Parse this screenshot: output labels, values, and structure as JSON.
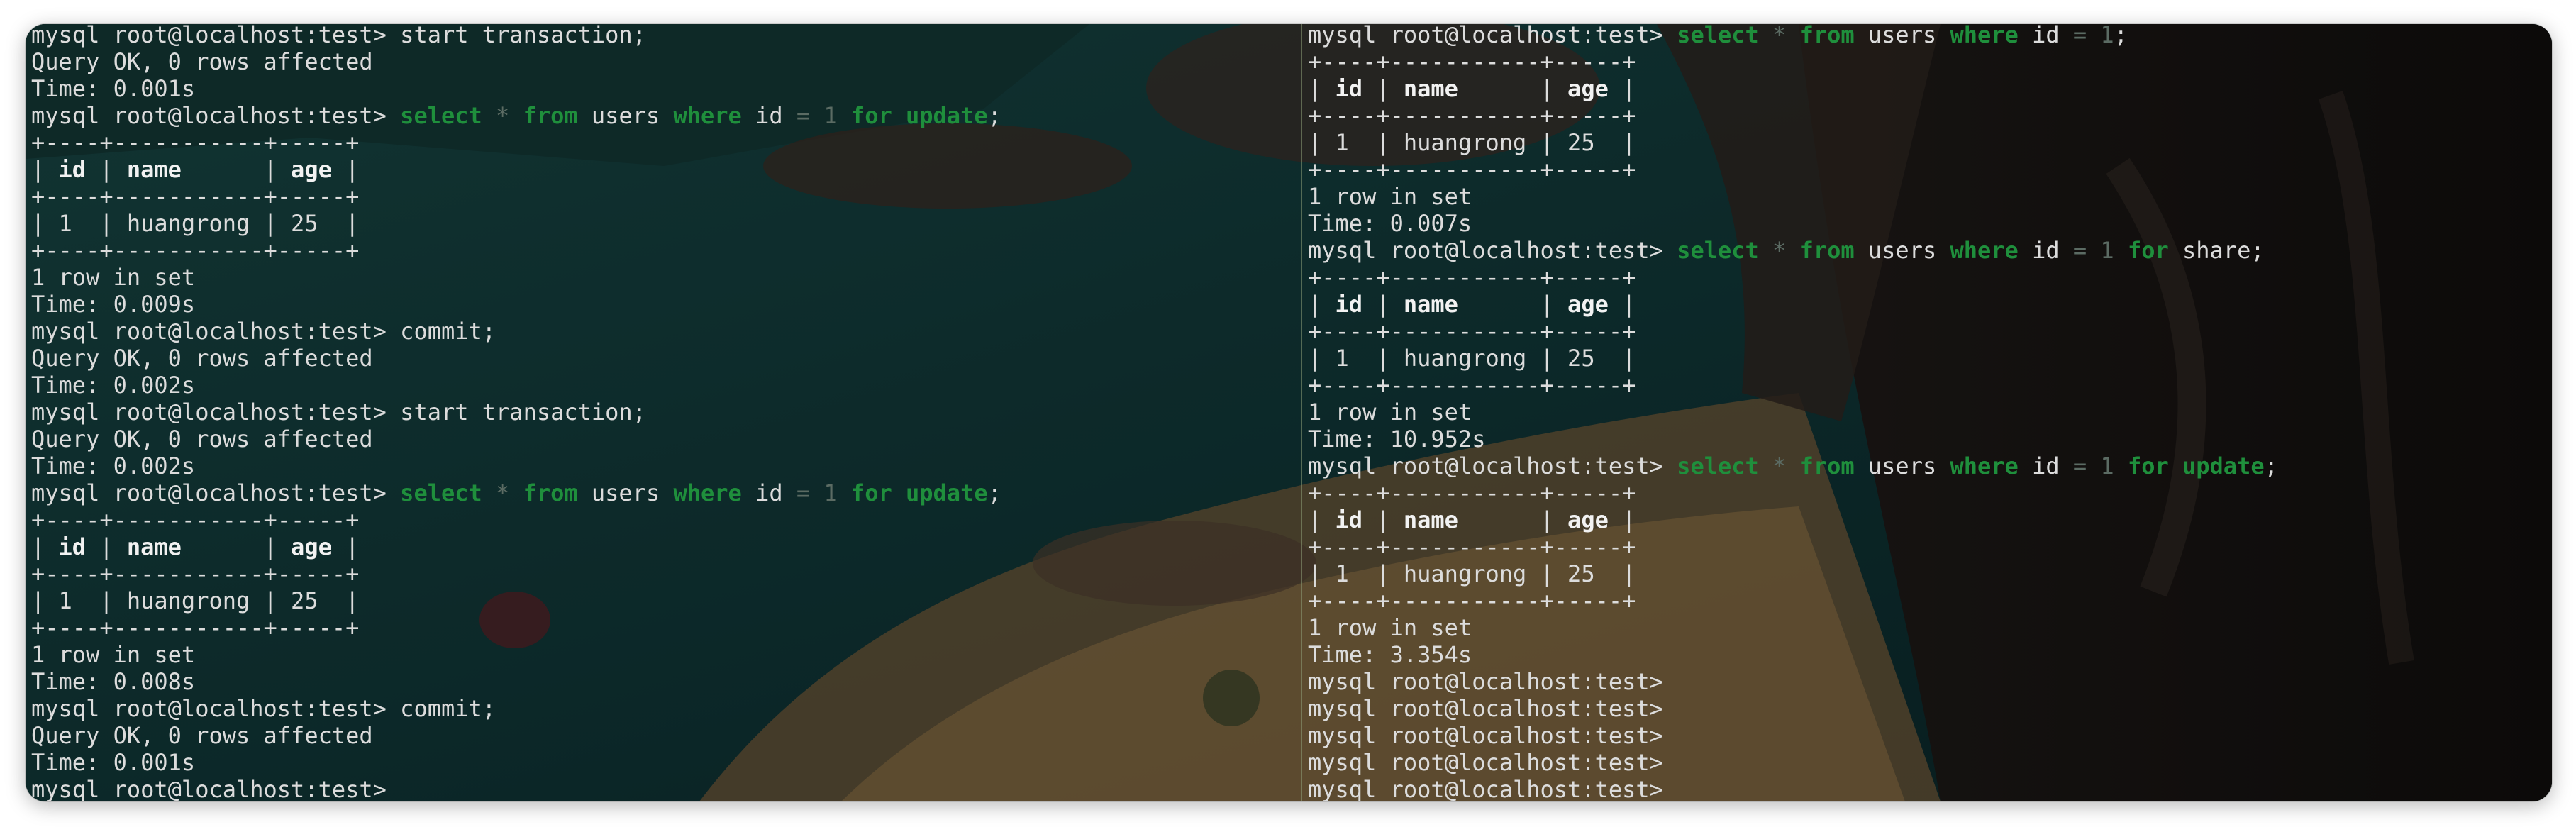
{
  "colors": {
    "text": "#dcdcdc",
    "keyword": "#1f8f3c",
    "dim": "#5b6b63",
    "header": "#f2f2f2",
    "divider": "#8fa07a"
  },
  "terminal": {
    "left_pane": [
      [
        {
          "t": "mysql root@localhost:test> start transaction;"
        }
      ],
      [
        {
          "t": "Query OK, 0 rows affected"
        }
      ],
      [
        {
          "t": "Time: 0.001s"
        }
      ],
      [
        {
          "t": "mysql root@localhost:test> "
        },
        {
          "t": "select",
          "c": "kw"
        },
        {
          "t": " "
        },
        {
          "t": "*",
          "c": "dim"
        },
        {
          "t": " "
        },
        {
          "t": "from",
          "c": "kw"
        },
        {
          "t": " users "
        },
        {
          "t": "where",
          "c": "kw"
        },
        {
          "t": " id "
        },
        {
          "t": "=",
          "c": "dim"
        },
        {
          "t": " "
        },
        {
          "t": "1",
          "c": "dim"
        },
        {
          "t": " "
        },
        {
          "t": "for",
          "c": "kw"
        },
        {
          "t": " "
        },
        {
          "t": "update",
          "c": "kw"
        },
        {
          "t": ";"
        }
      ],
      [
        {
          "t": "+----+-----------+-----+"
        }
      ],
      [
        {
          "t": "| "
        },
        {
          "t": "id",
          "c": "bold"
        },
        {
          "t": " | "
        },
        {
          "t": "name",
          "c": "bold"
        },
        {
          "t": "      | "
        },
        {
          "t": "age",
          "c": "bold"
        },
        {
          "t": " |"
        }
      ],
      [
        {
          "t": "+----+-----------+-----+"
        }
      ],
      [
        {
          "t": "| 1  | huangrong | 25  |"
        }
      ],
      [
        {
          "t": "+----+-----------+-----+"
        }
      ],
      [
        {
          "t": "1 row in set"
        }
      ],
      [
        {
          "t": "Time: 0.009s"
        }
      ],
      [
        {
          "t": "mysql root@localhost:test> commit;"
        }
      ],
      [
        {
          "t": "Query OK, 0 rows affected"
        }
      ],
      [
        {
          "t": "Time: 0.002s"
        }
      ],
      [
        {
          "t": "mysql root@localhost:test> start transaction;"
        }
      ],
      [
        {
          "t": "Query OK, 0 rows affected"
        }
      ],
      [
        {
          "t": "Time: 0.002s"
        }
      ],
      [
        {
          "t": "mysql root@localhost:test> "
        },
        {
          "t": "select",
          "c": "kw"
        },
        {
          "t": " "
        },
        {
          "t": "*",
          "c": "dim"
        },
        {
          "t": " "
        },
        {
          "t": "from",
          "c": "kw"
        },
        {
          "t": " users "
        },
        {
          "t": "where",
          "c": "kw"
        },
        {
          "t": " id "
        },
        {
          "t": "=",
          "c": "dim"
        },
        {
          "t": " "
        },
        {
          "t": "1",
          "c": "dim"
        },
        {
          "t": " "
        },
        {
          "t": "for",
          "c": "kw"
        },
        {
          "t": " "
        },
        {
          "t": "update",
          "c": "kw"
        },
        {
          "t": ";"
        }
      ],
      [
        {
          "t": "+----+-----------+-----+"
        }
      ],
      [
        {
          "t": "| "
        },
        {
          "t": "id",
          "c": "bold"
        },
        {
          "t": " | "
        },
        {
          "t": "name",
          "c": "bold"
        },
        {
          "t": "      | "
        },
        {
          "t": "age",
          "c": "bold"
        },
        {
          "t": " |"
        }
      ],
      [
        {
          "t": "+----+-----------+-----+"
        }
      ],
      [
        {
          "t": "| 1  | huangrong | 25  |"
        }
      ],
      [
        {
          "t": "+----+-----------+-----+"
        }
      ],
      [
        {
          "t": "1 row in set"
        }
      ],
      [
        {
          "t": "Time: 0.008s"
        }
      ],
      [
        {
          "t": "mysql root@localhost:test> commit;"
        }
      ],
      [
        {
          "t": "Query OK, 0 rows affected"
        }
      ],
      [
        {
          "t": "Time: 0.001s"
        }
      ],
      [
        {
          "t": "mysql root@localhost:test>"
        }
      ]
    ],
    "right_pane": [
      [
        {
          "t": "mysql root@localhost:test> "
        },
        {
          "t": "select",
          "c": "kw"
        },
        {
          "t": " "
        },
        {
          "t": "*",
          "c": "dim"
        },
        {
          "t": " "
        },
        {
          "t": "from",
          "c": "kw"
        },
        {
          "t": " users "
        },
        {
          "t": "where",
          "c": "kw"
        },
        {
          "t": " id "
        },
        {
          "t": "=",
          "c": "dim"
        },
        {
          "t": " "
        },
        {
          "t": "1",
          "c": "dim"
        },
        {
          "t": ";"
        }
      ],
      [
        {
          "t": "+----+-----------+-----+"
        }
      ],
      [
        {
          "t": "| "
        },
        {
          "t": "id",
          "c": "bold"
        },
        {
          "t": " | "
        },
        {
          "t": "name",
          "c": "bold"
        },
        {
          "t": "      | "
        },
        {
          "t": "age",
          "c": "bold"
        },
        {
          "t": " |"
        }
      ],
      [
        {
          "t": "+----+-----------+-----+"
        }
      ],
      [
        {
          "t": "| 1  | huangrong | 25  |"
        }
      ],
      [
        {
          "t": "+----+-----------+-----+"
        }
      ],
      [
        {
          "t": "1 row in set"
        }
      ],
      [
        {
          "t": "Time: 0.007s"
        }
      ],
      [
        {
          "t": "mysql root@localhost:test> "
        },
        {
          "t": "select",
          "c": "kw"
        },
        {
          "t": " "
        },
        {
          "t": "*",
          "c": "dim"
        },
        {
          "t": " "
        },
        {
          "t": "from",
          "c": "kw"
        },
        {
          "t": " users "
        },
        {
          "t": "where",
          "c": "kw"
        },
        {
          "t": " id "
        },
        {
          "t": "=",
          "c": "dim"
        },
        {
          "t": " "
        },
        {
          "t": "1",
          "c": "dim"
        },
        {
          "t": " "
        },
        {
          "t": "for",
          "c": "kw"
        },
        {
          "t": " share;"
        }
      ],
      [
        {
          "t": "+----+-----------+-----+"
        }
      ],
      [
        {
          "t": "| "
        },
        {
          "t": "id",
          "c": "bold"
        },
        {
          "t": " | "
        },
        {
          "t": "name",
          "c": "bold"
        },
        {
          "t": "      | "
        },
        {
          "t": "age",
          "c": "bold"
        },
        {
          "t": " |"
        }
      ],
      [
        {
          "t": "+----+-----------+-----+"
        }
      ],
      [
        {
          "t": "| 1  | huangrong | 25  |"
        }
      ],
      [
        {
          "t": "+----+-----------+-----+"
        }
      ],
      [
        {
          "t": "1 row in set"
        }
      ],
      [
        {
          "t": "Time: 10.952s"
        }
      ],
      [
        {
          "t": "mysql root@localhost:test> "
        },
        {
          "t": "select",
          "c": "kw"
        },
        {
          "t": " "
        },
        {
          "t": "*",
          "c": "dim"
        },
        {
          "t": " "
        },
        {
          "t": "from",
          "c": "kw"
        },
        {
          "t": " users "
        },
        {
          "t": "where",
          "c": "kw"
        },
        {
          "t": " id "
        },
        {
          "t": "=",
          "c": "dim"
        },
        {
          "t": " "
        },
        {
          "t": "1",
          "c": "dim"
        },
        {
          "t": " "
        },
        {
          "t": "for",
          "c": "kw"
        },
        {
          "t": " "
        },
        {
          "t": "update",
          "c": "kw"
        },
        {
          "t": ";"
        }
      ],
      [
        {
          "t": "+----+-----------+-----+"
        }
      ],
      [
        {
          "t": "| "
        },
        {
          "t": "id",
          "c": "bold"
        },
        {
          "t": " | "
        },
        {
          "t": "name",
          "c": "bold"
        },
        {
          "t": "      | "
        },
        {
          "t": "age",
          "c": "bold"
        },
        {
          "t": " |"
        }
      ],
      [
        {
          "t": "+----+-----------+-----+"
        }
      ],
      [
        {
          "t": "| 1  | huangrong | 25  |"
        }
      ],
      [
        {
          "t": "+----+-----------+-----+"
        }
      ],
      [
        {
          "t": "1 row in set"
        }
      ],
      [
        {
          "t": "Time: 3.354s"
        }
      ],
      [
        {
          "t": "mysql root@localhost:test>"
        }
      ],
      [
        {
          "t": "mysql root@localhost:test>"
        }
      ],
      [
        {
          "t": "mysql root@localhost:test>"
        }
      ],
      [
        {
          "t": "mysql root@localhost:test>"
        }
      ],
      [
        {
          "t": "mysql root@localhost:test>"
        }
      ]
    ]
  }
}
